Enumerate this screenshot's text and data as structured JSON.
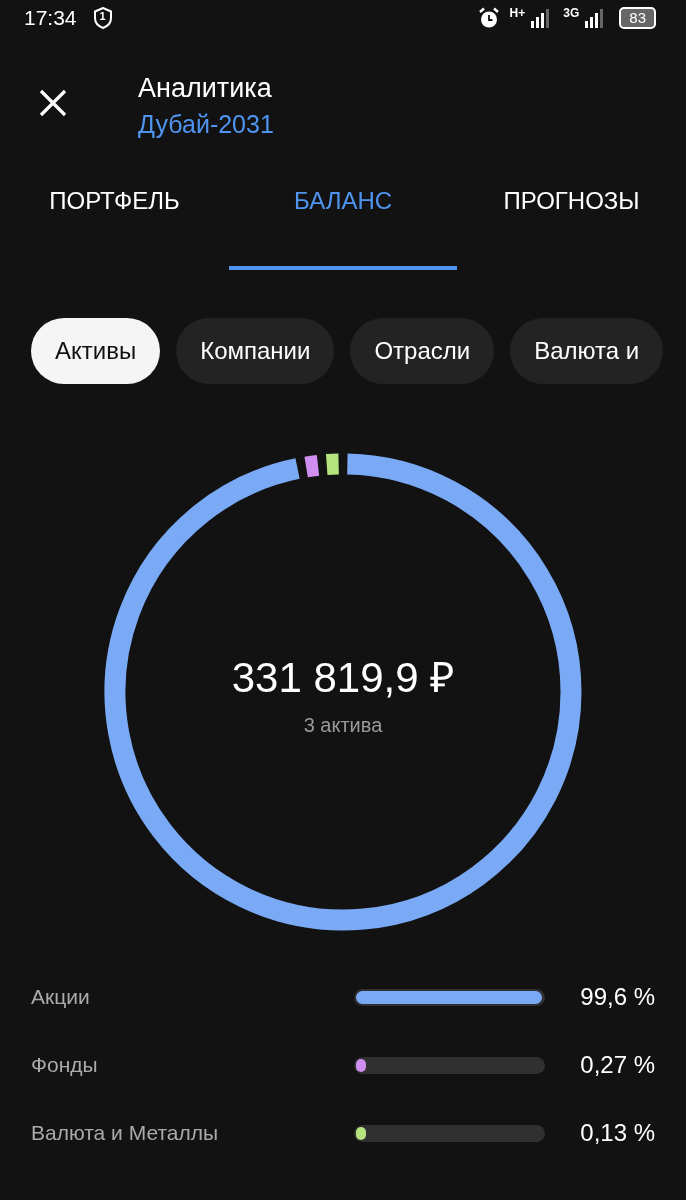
{
  "status_bar": {
    "time": "17:34",
    "shield_badge": "1",
    "network_1": "H+",
    "network_2": "3G",
    "battery": "83"
  },
  "header": {
    "title": "Аналитика",
    "subtitle": "Дубай-2031"
  },
  "tabs": [
    {
      "label": "ПОРТФЕЛЬ",
      "selected": false
    },
    {
      "label": "БАЛАНС",
      "selected": true
    },
    {
      "label": "ПРОГНОЗЫ",
      "selected": false
    }
  ],
  "chips": [
    {
      "label": "Активы",
      "selected": true
    },
    {
      "label": "Компании",
      "selected": false
    },
    {
      "label": "Отрасли",
      "selected": false
    },
    {
      "label": "Валюта и",
      "selected": false
    }
  ],
  "total": {
    "amount": "331 819,9 ₽",
    "caption": "3 актива"
  },
  "assets": [
    {
      "name": "Акции",
      "level": 0.996,
      "percent": "99,6 %",
      "color": "#7aaaf6"
    },
    {
      "name": "Фонды",
      "level": 0.0027,
      "percent": "0,27 %",
      "color": "#d08ef0"
    },
    {
      "name": "Валюта и Металлы",
      "level": 0.0013,
      "percent": "0,13 %",
      "color": "#b5e37e"
    }
  ]
}
